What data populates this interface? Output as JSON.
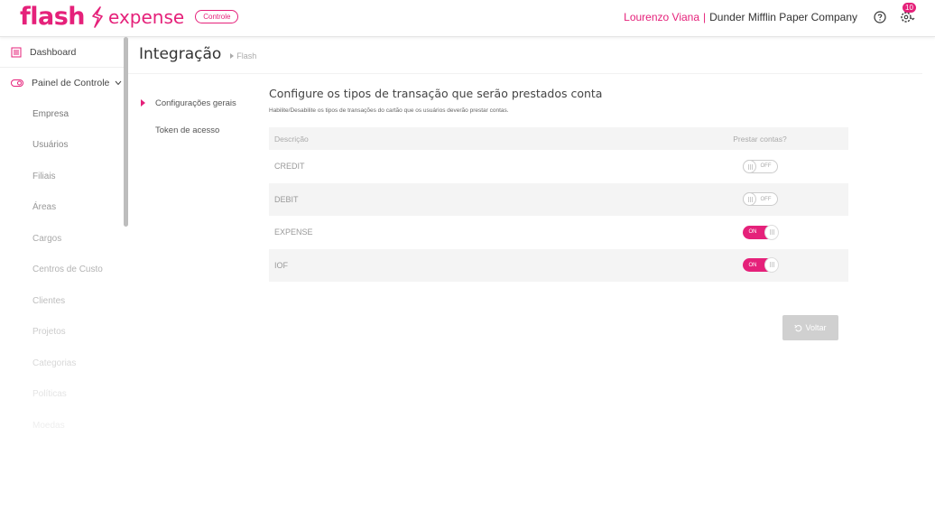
{
  "header": {
    "logo_flash": "flash",
    "logo_expense": "expense",
    "badge": "Controle",
    "user_name": "Lourenzo Viana",
    "separator": "|",
    "company": "Dunder Mifflin Paper Company",
    "notification_count": "10",
    "accent_color": "#e5217a"
  },
  "sidebar": {
    "dashboard": "Dashboard",
    "painel": "Painel de Controle",
    "items": [
      "Empresa",
      "Usuários",
      "Filiais",
      "Áreas",
      "Cargos",
      "Centros de Custo",
      "Clientes",
      "Projetos",
      "Categorias",
      "Políticas",
      "Moedas"
    ]
  },
  "page": {
    "title": "Integração",
    "breadcrumb": "Flash"
  },
  "subnav": {
    "items": [
      "Configurações gerais",
      "Token de acesso"
    ],
    "active": "Configurações gerais"
  },
  "content": {
    "title": "Configure os tipos de transação que serão prestados conta",
    "description": "Habilite/Desabilite os tipos de transações do cartão que os usuários deverão prestar contas.",
    "col_desc": "Descrição",
    "col_prestar": "Prestar contas?",
    "rows": [
      {
        "name": "CREDIT",
        "state": "OFF"
      },
      {
        "name": "DEBIT",
        "state": "OFF"
      },
      {
        "name": "EXPENSE",
        "state": "ON"
      },
      {
        "name": "IOF",
        "state": "ON"
      }
    ]
  },
  "actions": {
    "voltar": "Voltar"
  }
}
